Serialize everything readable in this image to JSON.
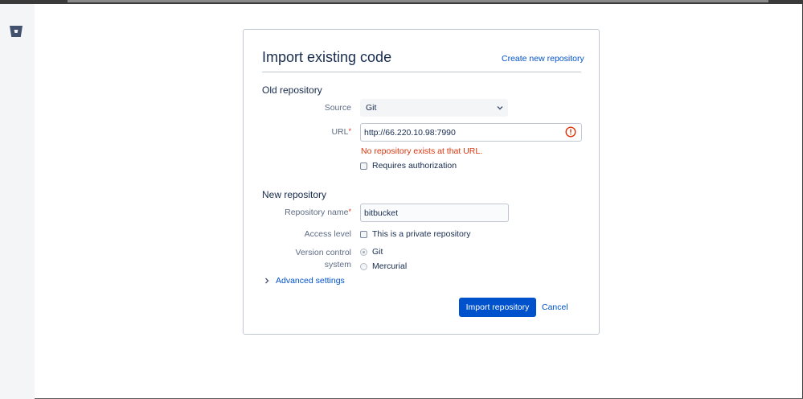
{
  "form": {
    "title": "Import existing code",
    "create_link": "Create new repository",
    "old_section": "Old repository",
    "source_label": "Source",
    "source_value": "Git",
    "url_label": "URL",
    "url_value": "http://66.220.10.98:7990",
    "url_error": "No repository exists at that URL.",
    "requires_auth": "Requires authorization",
    "new_section": "New repository",
    "name_label": "Repository name",
    "name_value": "bitbucket",
    "access_label": "Access level",
    "private_label": "This is a private repository",
    "vcs_label_line1": "Version control",
    "vcs_label_line2": "system",
    "vcs_git": "Git",
    "vcs_mercurial": "Mercurial",
    "advanced": "Advanced settings",
    "import_button": "Import repository",
    "cancel": "Cancel",
    "required_mark": "*"
  },
  "icons": {
    "logo": "bitbucket-logo-icon",
    "error": "error-icon",
    "select": "chevron-down-icon",
    "advanced": "chevron-right-icon"
  },
  "colors": {
    "primary": "#0052cc",
    "error": "#de350b",
    "sidebar": "#f4f5f7",
    "text": "#172b4d"
  }
}
